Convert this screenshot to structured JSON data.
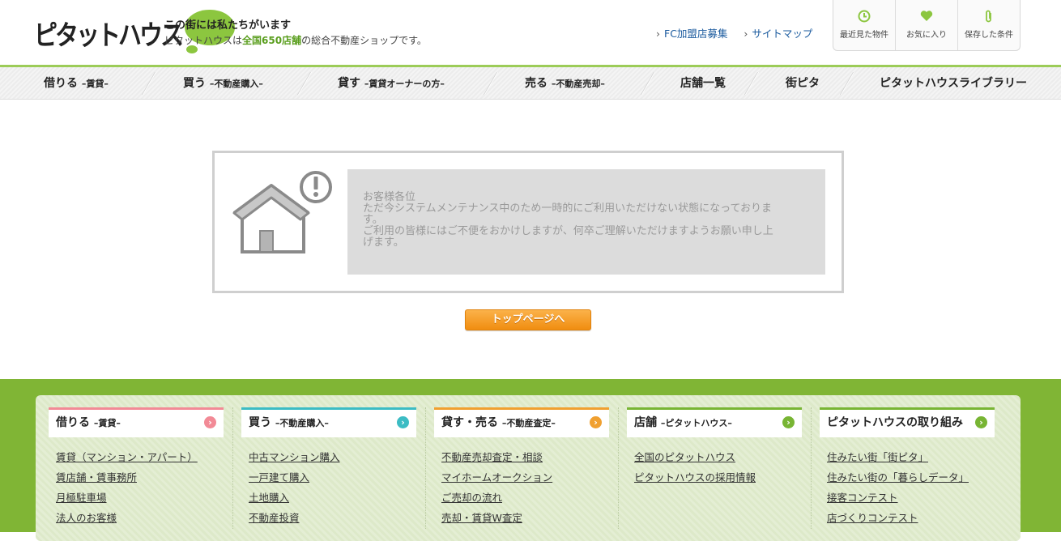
{
  "header": {
    "logo_text": "ピタットハウス",
    "tagline_main": "この街には私たちがいます",
    "tagline_pre": "ピタットハウスは",
    "tagline_highlight": "全国650店舗",
    "tagline_post": "の総合不動産ショップです。",
    "links": [
      "FC加盟店募集",
      "サイトマップ"
    ],
    "util": [
      {
        "label": "最近見た物件",
        "icon": "clock-icon"
      },
      {
        "label": "お気に入り",
        "icon": "heart-icon"
      },
      {
        "label": "保存した条件",
        "icon": "paperclip-icon"
      }
    ]
  },
  "nav": [
    {
      "label": "借りる",
      "sub": "–賃貸–"
    },
    {
      "label": "買う",
      "sub": "–不動産購入–"
    },
    {
      "label": "貸す",
      "sub": "–賃貸オーナーの方–"
    },
    {
      "label": "売る",
      "sub": "–不動産売却–"
    },
    {
      "label": "店舗一覧",
      "sub": ""
    },
    {
      "label": "街ピタ",
      "sub": ""
    },
    {
      "label": "ピタットハウスライブラリー",
      "sub": ""
    }
  ],
  "notice": {
    "lines": [
      "お客様各位",
      "ただ今システムメンテナンス中のため一時的にご利用いただけない状態になっておりま",
      "す。",
      "ご利用の皆様にはご不便をおかけしますが、何卒ご理解いただけますようお願い申し上",
      "げます。"
    ]
  },
  "top_button": "トップページへ",
  "colors": {
    "brand_green": "#8cc63f",
    "footer_green": "#80b535",
    "button_orange": "#f29a1f"
  },
  "footer": [
    {
      "title": "借りる",
      "sub": "–賃貸–",
      "color": "#f28a96",
      "links": [
        "賃貸（マンション・アパート）",
        "賃店舗・賃事務所",
        "月極駐車場",
        "法人のお客様"
      ]
    },
    {
      "title": "買う",
      "sub": "–不動産購入–",
      "color": "#3cbcc4",
      "links": [
        "中古マンション購入",
        "一戸建て購入",
        "土地購入",
        "不動産投資"
      ]
    },
    {
      "title": "貸す・売る",
      "sub": "–不動産査定–",
      "color": "#f0a030",
      "links": [
        "不動産売却査定・相談",
        "マイホームオークション",
        "ご売却の流れ",
        "売却・賃貸W査定"
      ]
    },
    {
      "title": "店舗",
      "sub": "–ピタットハウス–",
      "color": "#78b534",
      "links": [
        "全国のピタットハウス",
        "ピタットハウスの採用情報"
      ]
    },
    {
      "title": "ピタットハウスの取り組み",
      "sub": "",
      "color": "#78b534",
      "links": [
        "住みたい街「街ピタ」",
        "住みたい街の「暮らしデータ」",
        "接客コンテスト",
        "店づくりコンテスト"
      ]
    }
  ]
}
